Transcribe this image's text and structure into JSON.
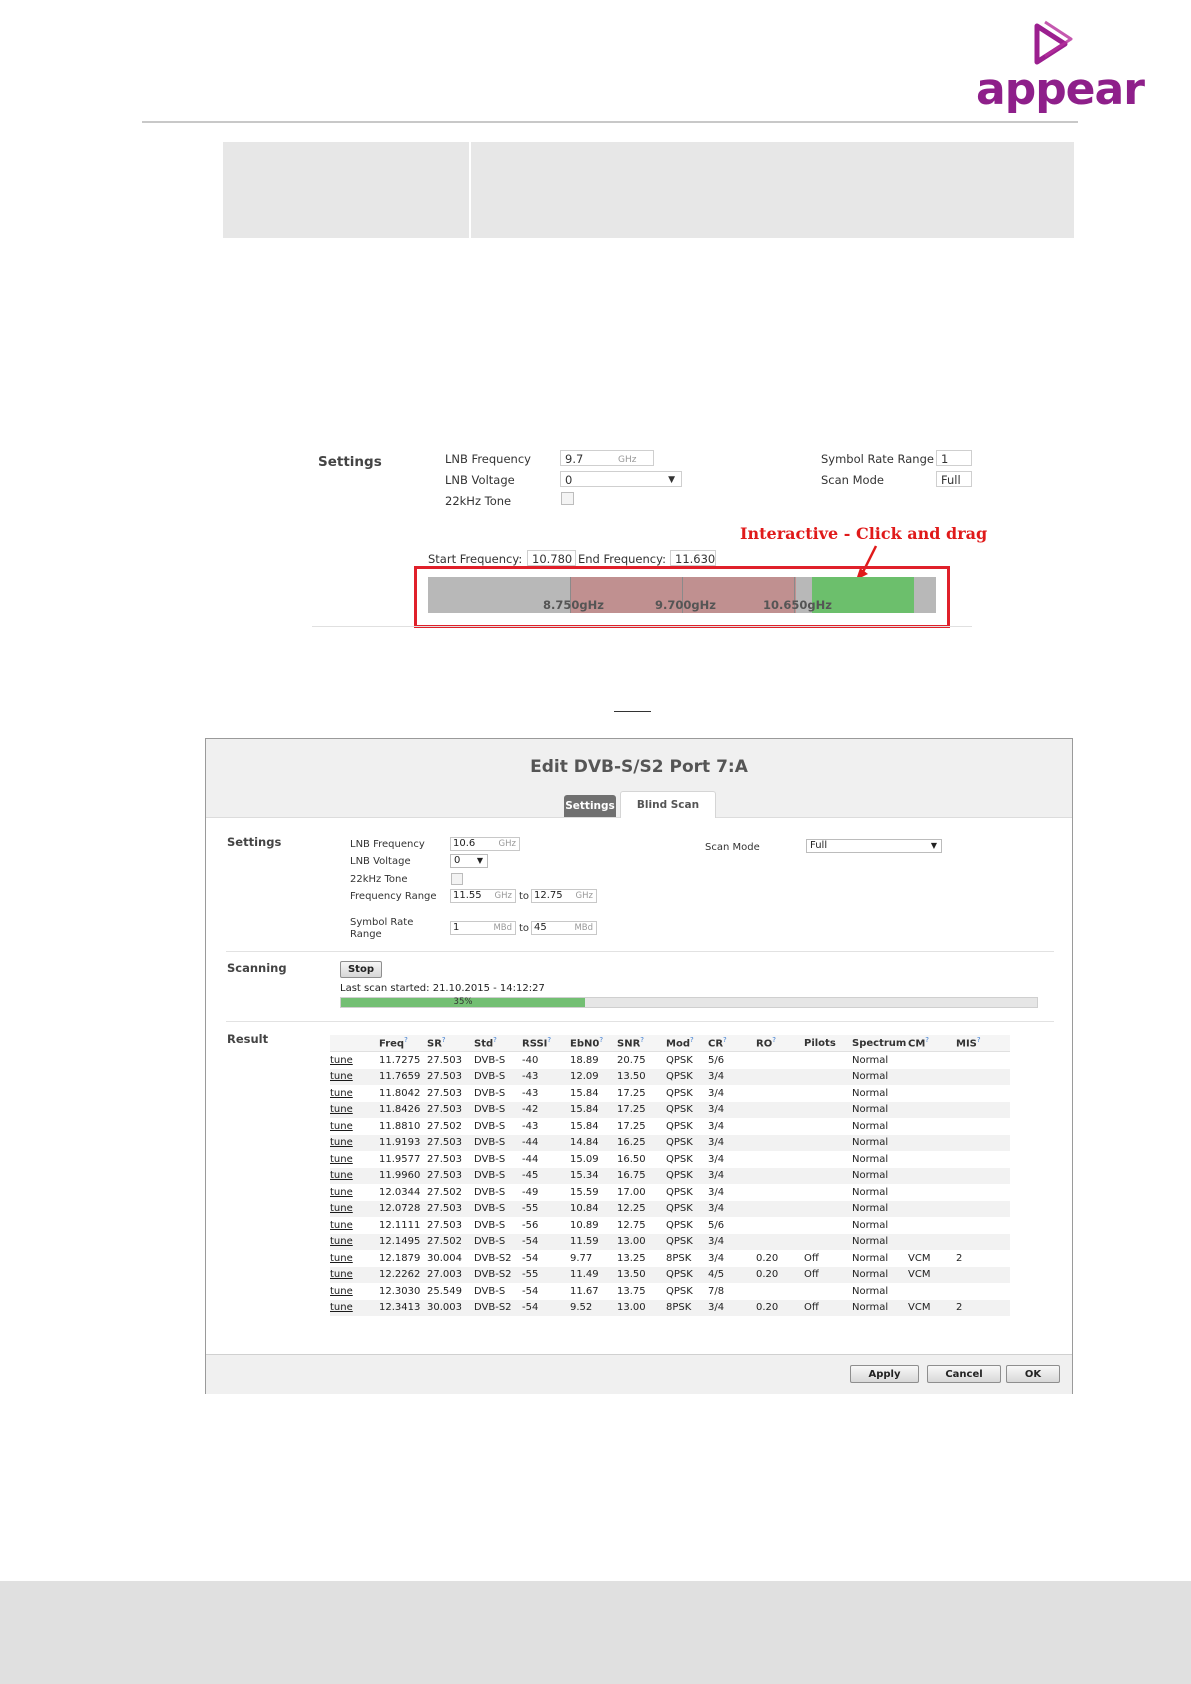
{
  "header": {
    "logo_text": "appear"
  },
  "figure1": {
    "settings_title": "Settings",
    "lnb_frequency_label": "LNB Frequency",
    "lnb_frequency_value": "9.7",
    "lnb_frequency_unit": "GHz",
    "lnb_voltage_label": "LNB Voltage",
    "lnb_voltage_value": "0",
    "tone_label": "22kHz Tone",
    "symbol_rate_label": "Symbol Rate Range",
    "symbol_rate_value": "1",
    "scan_mode_label": "Scan Mode",
    "scan_mode_value": "Full",
    "annotation": "Interactive - Click and drag",
    "start_freq_label": "Start Frequency:",
    "start_freq_value": "10.780",
    "end_freq_label": "End Frequency:",
    "end_freq_value": "11.630",
    "slider_ticks": [
      "8.750gHz",
      "9.700gHz",
      "10.650gHz"
    ]
  },
  "dialog": {
    "title": "Edit DVB-S/S2 Port 7:A",
    "tabs": [
      "Settings",
      "Blind Scan"
    ],
    "settings": {
      "section": "Settings",
      "lnb_frequency_label": "LNB Frequency",
      "lnb_frequency_value": "10.6",
      "ghz": "GHz",
      "lnb_voltage_label": "LNB Voltage",
      "lnb_voltage_value": "0",
      "tone_label": "22kHz Tone",
      "freq_range_label": "Frequency Range",
      "freq_from": "11.55",
      "freq_to": "12.75",
      "to": "to",
      "symbol_rate_label_1": "Symbol Rate",
      "symbol_rate_label_2": "Range",
      "sr_from": "1",
      "sr_to": "45",
      "mbd": "MBd",
      "scan_mode_label": "Scan Mode",
      "scan_mode_value": "Full"
    },
    "scanning": {
      "section": "Scanning",
      "stop_label": "Stop",
      "status": "Last scan started: 21.10.2015 - 14:12:27",
      "progress": 0.35,
      "progress_label": "35%"
    },
    "result": {
      "section": "Result",
      "columns": [
        "",
        "Freq",
        "SR",
        "Std",
        "RSSI",
        "EbN0",
        "SNR",
        "Mod",
        "CR",
        "RO",
        "Pilots",
        "Spectrum",
        "CM",
        "MIS"
      ],
      "rows": [
        [
          "tune",
          "11.7275",
          "27.503",
          "DVB-S",
          "-40",
          "18.89",
          "20.75",
          "QPSK",
          "5/6",
          "",
          "",
          "Normal",
          "",
          ""
        ],
        [
          "tune",
          "11.7659",
          "27.503",
          "DVB-S",
          "-43",
          "12.09",
          "13.50",
          "QPSK",
          "3/4",
          "",
          "",
          "Normal",
          "",
          ""
        ],
        [
          "tune",
          "11.8042",
          "27.503",
          "DVB-S",
          "-43",
          "15.84",
          "17.25",
          "QPSK",
          "3/4",
          "",
          "",
          "Normal",
          "",
          ""
        ],
        [
          "tune",
          "11.8426",
          "27.503",
          "DVB-S",
          "-42",
          "15.84",
          "17.25",
          "QPSK",
          "3/4",
          "",
          "",
          "Normal",
          "",
          ""
        ],
        [
          "tune",
          "11.8810",
          "27.502",
          "DVB-S",
          "-43",
          "15.84",
          "17.25",
          "QPSK",
          "3/4",
          "",
          "",
          "Normal",
          "",
          ""
        ],
        [
          "tune",
          "11.9193",
          "27.503",
          "DVB-S",
          "-44",
          "14.84",
          "16.25",
          "QPSK",
          "3/4",
          "",
          "",
          "Normal",
          "",
          ""
        ],
        [
          "tune",
          "11.9577",
          "27.503",
          "DVB-S",
          "-44",
          "15.09",
          "16.50",
          "QPSK",
          "3/4",
          "",
          "",
          "Normal",
          "",
          ""
        ],
        [
          "tune",
          "11.9960",
          "27.503",
          "DVB-S",
          "-45",
          "15.34",
          "16.75",
          "QPSK",
          "3/4",
          "",
          "",
          "Normal",
          "",
          ""
        ],
        [
          "tune",
          "12.0344",
          "27.502",
          "DVB-S",
          "-49",
          "15.59",
          "17.00",
          "QPSK",
          "3/4",
          "",
          "",
          "Normal",
          "",
          ""
        ],
        [
          "tune",
          "12.0728",
          "27.503",
          "DVB-S",
          "-55",
          "10.84",
          "12.25",
          "QPSK",
          "3/4",
          "",
          "",
          "Normal",
          "",
          ""
        ],
        [
          "tune",
          "12.1111",
          "27.503",
          "DVB-S",
          "-56",
          "10.89",
          "12.75",
          "QPSK",
          "5/6",
          "",
          "",
          "Normal",
          "",
          ""
        ],
        [
          "tune",
          "12.1495",
          "27.502",
          "DVB-S",
          "-54",
          "11.59",
          "13.00",
          "QPSK",
          "3/4",
          "",
          "",
          "Normal",
          "",
          ""
        ],
        [
          "tune",
          "12.1879",
          "30.004",
          "DVB-S2",
          "-54",
          "9.77",
          "13.25",
          "8PSK",
          "3/4",
          "0.20",
          "Off",
          "Normal",
          "VCM",
          "2"
        ],
        [
          "tune",
          "12.2262",
          "27.003",
          "DVB-S2",
          "-55",
          "11.49",
          "13.50",
          "QPSK",
          "4/5",
          "0.20",
          "Off",
          "Normal",
          "VCM",
          ""
        ],
        [
          "tune",
          "12.3030",
          "25.549",
          "DVB-S",
          "-54",
          "11.67",
          "13.75",
          "QPSK",
          "7/8",
          "",
          "",
          "Normal",
          "",
          ""
        ],
        [
          "tune",
          "12.3413",
          "30.003",
          "DVB-S2",
          "-54",
          "9.52",
          "13.00",
          "8PSK",
          "3/4",
          "0.20",
          "Off",
          "Normal",
          "VCM",
          "2"
        ]
      ]
    },
    "footer": {
      "apply": "Apply",
      "cancel": "Cancel",
      "ok": "OK"
    }
  },
  "colors": {
    "brand": "#8e1f8a",
    "annotation": "#e01a1a",
    "slider_selected": "#6cbf6c",
    "slider_range": "#c09090"
  }
}
